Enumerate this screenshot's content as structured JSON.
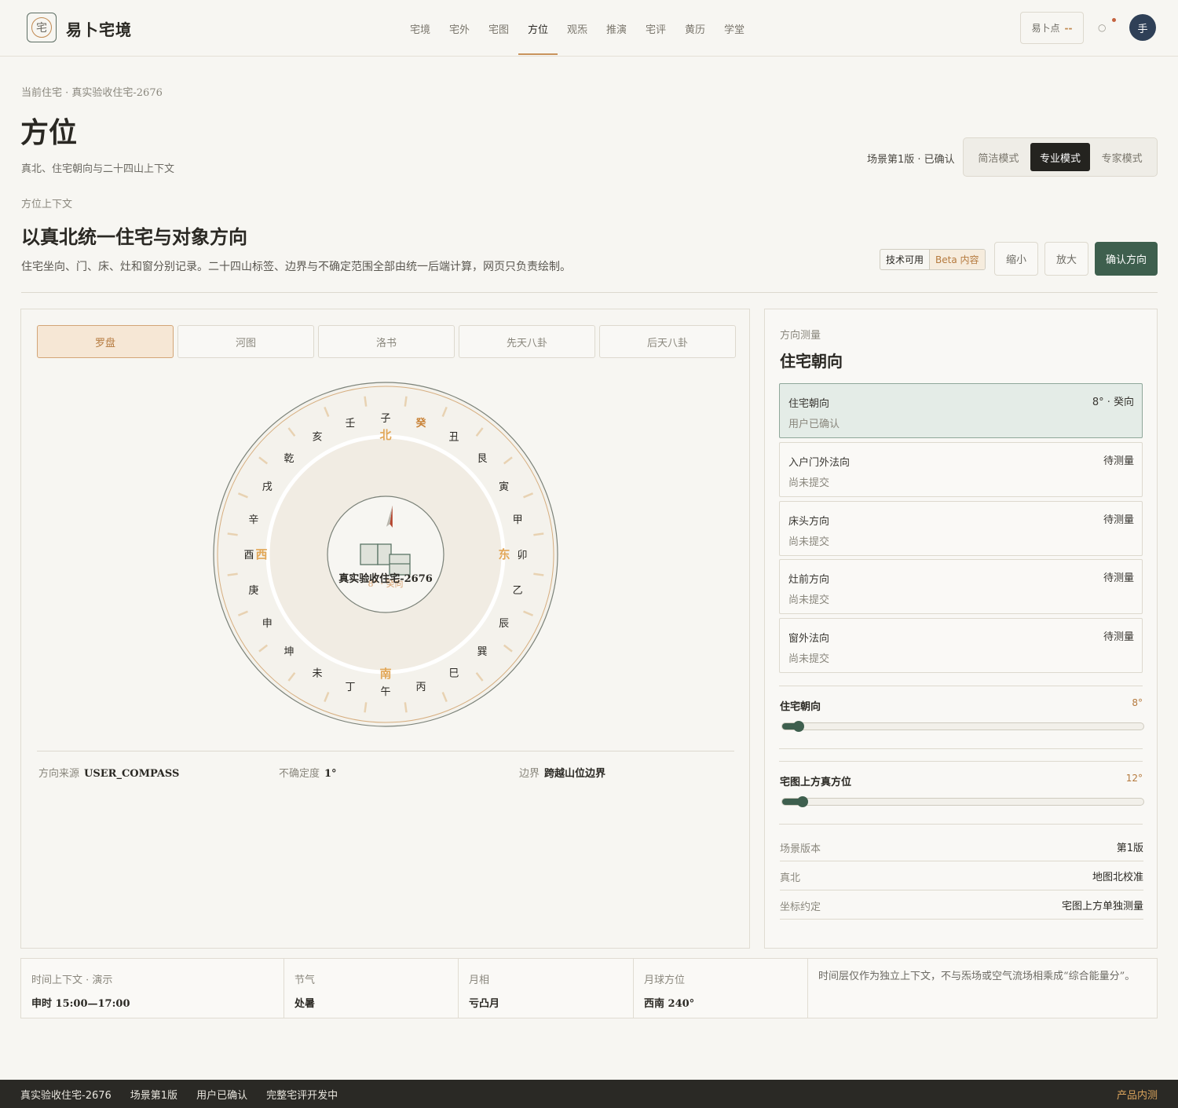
{
  "app": {
    "logo_char": "宅",
    "brand": "易卜宅境"
  },
  "nav": {
    "items": [
      "宅境",
      "宅外",
      "宅图",
      "方位",
      "观炁",
      "推演",
      "宅评",
      "黄历",
      "学堂"
    ],
    "active": "方位"
  },
  "header": {
    "points_label": "易卜点",
    "points_value": "--",
    "bell_icon": "○",
    "avatar_char": "手"
  },
  "page": {
    "breadcrumb": "当前住宅 · 真实验收住宅-2676",
    "title": "方位",
    "subtitle": "真北、住宅朝向与二十四山上下文",
    "scene_status": "场景第1版 · 已确认",
    "modes": [
      "简洁模式",
      "专业模式",
      "专家模式"
    ],
    "active_mode": "专业模式"
  },
  "context": {
    "label": "方位上下文",
    "heading": "以真北统一住宅与对象方向",
    "description": "住宅坐向、门、床、灶和窗分别记录。二十四山标签、边界与不确定范围全部由统一后端计算，网页只负责绘制。",
    "badge_status": "技术可用",
    "badge_beta": "Beta 内容",
    "zoom_out": "缩小",
    "zoom_in": "放大",
    "confirm": "确认方向"
  },
  "view_tabs": [
    "罗盘",
    "河图",
    "洛书",
    "先天八卦",
    "后天八卦"
  ],
  "active_view": "罗盘",
  "compass": {
    "mountains": [
      "子",
      "癸",
      "丑",
      "艮",
      "寅",
      "甲",
      "卯",
      "乙",
      "辰",
      "巽",
      "巳",
      "丙",
      "午",
      "丁",
      "未",
      "坤",
      "申",
      "庚",
      "酉",
      "辛",
      "戌",
      "乾",
      "亥",
      "壬"
    ],
    "highlight_mountain": "癸",
    "cardinals": {
      "north": "北",
      "east": "东",
      "south": "南",
      "west": "西"
    },
    "center_name": "真实验收住宅-2676",
    "center_reading": "8° · 癸向",
    "needle_deg": 8,
    "colors": {
      "accent": "#e2a758",
      "highlight": "#c98338",
      "needle": "#b5432c",
      "house": "#5b7566"
    }
  },
  "source": {
    "k1": "方向来源",
    "v1": "USER_COMPASS",
    "k2": "不确定度",
    "v2": "1°",
    "k3": "边界",
    "v3": "跨越山位边界"
  },
  "measure": {
    "label": "方向测量",
    "title": "住宅朝向",
    "cards": [
      {
        "name": "住宅朝向",
        "value": "8° · 癸向",
        "status": "用户已确认"
      },
      {
        "name": "入户门外法向",
        "value": "待测量",
        "status": "尚未提交"
      },
      {
        "name": "床头方向",
        "value": "待测量",
        "status": "尚未提交"
      },
      {
        "name": "灶前方向",
        "value": "待测量",
        "status": "尚未提交"
      },
      {
        "name": "窗外法向",
        "value": "待测量",
        "status": "尚未提交"
      }
    ],
    "slider1": {
      "label": "住宅朝向",
      "value_text": "8°",
      "value": 8,
      "max": 360
    },
    "slider2": {
      "label": "宅图上方真方位",
      "value_text": "12°",
      "value": 12,
      "max": 360
    },
    "info": [
      {
        "k": "场景版本",
        "v": "第1版"
      },
      {
        "k": "真北",
        "v": "地图北校准"
      },
      {
        "k": "坐标约定",
        "v": "宅图上方单独测量"
      }
    ]
  },
  "time": {
    "k1": "时间上下文 · 演示",
    "v1": "申时 15:00—17:00",
    "k2": "节气",
    "v2": "处暑",
    "k3": "月相",
    "v3": "亏凸月",
    "k4": "月球方位",
    "v4": "西南 240°",
    "note": "时间层仅作为独立上下文，不与炁场或空气流场相乘成“综合能量分”。"
  },
  "footer": {
    "items": [
      "真实验收住宅-2676",
      "场景第1版",
      "用户已确认",
      "完整宅评开发中"
    ],
    "right": "产品内测"
  }
}
